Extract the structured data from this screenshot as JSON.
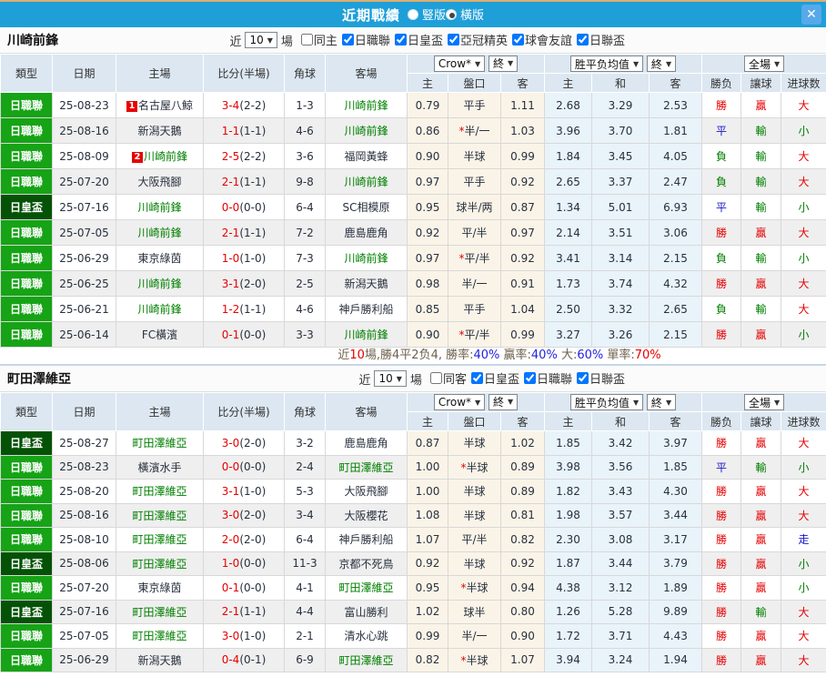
{
  "titlebar": {
    "title": "近期戰績",
    "radio_options": [
      {
        "label": "豎版",
        "selected": false
      },
      {
        "label": "橫版",
        "selected": true
      }
    ],
    "close_glyph": "✕"
  },
  "cup_label": "日皇盃",
  "columns": {
    "type": "類型",
    "date": "日期",
    "home": "主場",
    "score": "比分(半場)",
    "corner": "角球",
    "away": "客場",
    "odds_company": "Crow*",
    "time_final": "終",
    "odds_home": "主",
    "odds_handicap": "盤口",
    "odds_away": "客",
    "avg_label": "胜平负均值",
    "avg_home": "主",
    "avg_draw": "和",
    "avg_away": "客",
    "scope": "全場",
    "result": "勝负",
    "handicap_result": "讓球",
    "goals": "进球数"
  },
  "colors": {
    "topbar_blue": "#1E9FD8",
    "league_badge_green": "#16A316",
    "cup_badge_dark_green": "#045206",
    "win_red": "#E60000",
    "draw_blue": "#1717CC",
    "lose_green": "#008000",
    "team_green": "#008000",
    "odds_bg": "#FAF4E8",
    "avg_bg": "#E9F3FA"
  },
  "sections": [
    {
      "team": "川崎前鋒",
      "filter": {
        "near_label": "近",
        "count": "10",
        "games_label": "場",
        "checkboxes": [
          {
            "label": "同主",
            "checked": false
          },
          {
            "label": "日職聯",
            "checked": true
          },
          {
            "label": "日皇盃",
            "checked": true
          },
          {
            "label": "亞冠精英",
            "checked": true
          },
          {
            "label": "球會友誼",
            "checked": true
          },
          {
            "label": "日聯盃",
            "checked": true
          }
        ]
      },
      "rows": [
        {
          "lg": "日職聯",
          "date": "25-08-23",
          "home": "名古屋八鯨",
          "hb": "1",
          "score": "3-4",
          "half": "(2-2)",
          "corner": "1-3",
          "away": "川崎前鋒",
          "o1": "0.79",
          "hc": "平手",
          "o2": "1.11",
          "a1": "2.68",
          "a2": "3.29",
          "a3": "2.53",
          "res": "勝",
          "hres": "贏",
          "goal": "大"
        },
        {
          "lg": "日職聯",
          "date": "25-08-16",
          "home": "新潟天鵝",
          "score": "1-1",
          "half": "(1-1)",
          "corner": "4-6",
          "away": "川崎前鋒",
          "o1": "0.86",
          "hc": "*半/一",
          "o2": "1.03",
          "a1": "3.96",
          "a2": "3.70",
          "a3": "1.81",
          "res": "平",
          "hres": "輸",
          "goal": "小"
        },
        {
          "lg": "日職聯",
          "date": "25-08-09",
          "home": "川崎前鋒",
          "hb": "2",
          "score": "2-5",
          "half": "(2-2)",
          "corner": "3-6",
          "away": "福岡黃蜂",
          "o1": "0.90",
          "hc": "半球",
          "o2": "0.99",
          "a1": "1.84",
          "a2": "3.45",
          "a3": "4.05",
          "res": "負",
          "hres": "輸",
          "goal": "大"
        },
        {
          "lg": "日職聯",
          "date": "25-07-20",
          "home": "大阪飛腳",
          "score": "2-1",
          "half": "(1-1)",
          "corner": "9-8",
          "away": "川崎前鋒",
          "o1": "0.97",
          "hc": "平手",
          "o2": "0.92",
          "a1": "2.65",
          "a2": "3.37",
          "a3": "2.47",
          "res": "負",
          "hres": "輸",
          "goal": "大"
        },
        {
          "lg": "日皇盃",
          "date": "25-07-16",
          "home": "川崎前鋒",
          "score": "0-0",
          "half": "(0-0)",
          "corner": "6-4",
          "away": "SC相模原",
          "o1": "0.95",
          "hc": "球半/两",
          "o2": "0.87",
          "a1": "1.34",
          "a2": "5.01",
          "a3": "6.93",
          "res": "平",
          "hres": "輸",
          "goal": "小"
        },
        {
          "lg": "日職聯",
          "date": "25-07-05",
          "home": "川崎前鋒",
          "score": "2-1",
          "half": "(1-1)",
          "corner": "7-2",
          "away": "鹿島鹿角",
          "o1": "0.92",
          "hc": "平/半",
          "o2": "0.97",
          "a1": "2.14",
          "a2": "3.51",
          "a3": "3.06",
          "res": "勝",
          "hres": "贏",
          "goal": "大"
        },
        {
          "lg": "日職聯",
          "date": "25-06-29",
          "home": "東京綠茵",
          "score": "1-0",
          "half": "(1-0)",
          "corner": "7-3",
          "away": "川崎前鋒",
          "o1": "0.97",
          "hc": "*平/半",
          "o2": "0.92",
          "a1": "3.41",
          "a2": "3.14",
          "a3": "2.15",
          "res": "負",
          "hres": "輸",
          "goal": "小"
        },
        {
          "lg": "日職聯",
          "date": "25-06-25",
          "home": "川崎前鋒",
          "score": "3-1",
          "half": "(2-0)",
          "corner": "2-5",
          "away": "新潟天鵝",
          "o1": "0.98",
          "hc": "半/一",
          "o2": "0.91",
          "a1": "1.73",
          "a2": "3.74",
          "a3": "4.32",
          "res": "勝",
          "hres": "贏",
          "goal": "大"
        },
        {
          "lg": "日職聯",
          "date": "25-06-21",
          "home": "川崎前鋒",
          "score": "1-2",
          "half": "(1-1)",
          "corner": "4-6",
          "away": "神戶勝利船",
          "o1": "0.85",
          "hc": "平手",
          "o2": "1.04",
          "a1": "2.50",
          "a2": "3.32",
          "a3": "2.65",
          "res": "負",
          "hres": "輸",
          "goal": "大"
        },
        {
          "lg": "日職聯",
          "date": "25-06-14",
          "home": "FC橫濱",
          "score": "0-1",
          "half": "(0-0)",
          "corner": "3-3",
          "away": "川崎前鋒",
          "o1": "0.90",
          "hc": "*平/半",
          "o2": "0.99",
          "a1": "3.27",
          "a2": "3.26",
          "a3": "2.15",
          "res": "勝",
          "hres": "贏",
          "goal": "小"
        }
      ],
      "summary": [
        {
          "t": "近",
          "c": "plain"
        },
        {
          "t": "10",
          "c": "red"
        },
        {
          "t": "場,勝4平2负4, 勝率:",
          "c": "plain"
        },
        {
          "t": "40%",
          "c": "blue"
        },
        {
          "t": " 贏率:",
          "c": "plain"
        },
        {
          "t": "40%",
          "c": "blue"
        },
        {
          "t": " 大:",
          "c": "plain"
        },
        {
          "t": "60%",
          "c": "blue"
        },
        {
          "t": " 單率:",
          "c": "plain"
        },
        {
          "t": "70%",
          "c": "red"
        }
      ]
    },
    {
      "team": "町田澤維亞",
      "filter": {
        "near_label": "近",
        "count": "10",
        "games_label": "場",
        "checkboxes": [
          {
            "label": "同客",
            "checked": false
          },
          {
            "label": "日皇盃",
            "checked": true
          },
          {
            "label": "日職聯",
            "checked": true
          },
          {
            "label": "日聯盃",
            "checked": true
          }
        ]
      },
      "rows": [
        {
          "lg": "日皇盃",
          "date": "25-08-27",
          "home": "町田澤維亞",
          "score": "3-0",
          "half": "(2-0)",
          "corner": "3-2",
          "away": "鹿島鹿角",
          "o1": "0.87",
          "hc": "半球",
          "o2": "1.02",
          "a1": "1.85",
          "a2": "3.42",
          "a3": "3.97",
          "res": "勝",
          "hres": "贏",
          "goal": "大"
        },
        {
          "lg": "日職聯",
          "date": "25-08-23",
          "home": "橫濱水手",
          "score": "0-0",
          "half": "(0-0)",
          "corner": "2-4",
          "away": "町田澤維亞",
          "o1": "1.00",
          "hc": "*半球",
          "o2": "0.89",
          "a1": "3.98",
          "a2": "3.56",
          "a3": "1.85",
          "res": "平",
          "hres": "輸",
          "goal": "小"
        },
        {
          "lg": "日職聯",
          "date": "25-08-20",
          "home": "町田澤維亞",
          "score": "3-1",
          "half": "(1-0)",
          "corner": "5-3",
          "away": "大阪飛腳",
          "o1": "1.00",
          "hc": "半球",
          "o2": "0.89",
          "a1": "1.82",
          "a2": "3.43",
          "a3": "4.30",
          "res": "勝",
          "hres": "贏",
          "goal": "大"
        },
        {
          "lg": "日職聯",
          "date": "25-08-16",
          "home": "町田澤維亞",
          "score": "3-0",
          "half": "(2-0)",
          "corner": "3-4",
          "away": "大阪櫻花",
          "o1": "1.08",
          "hc": "半球",
          "o2": "0.81",
          "a1": "1.98",
          "a2": "3.57",
          "a3": "3.44",
          "res": "勝",
          "hres": "贏",
          "goal": "大"
        },
        {
          "lg": "日職聯",
          "date": "25-08-10",
          "home": "町田澤維亞",
          "score": "2-0",
          "half": "(2-0)",
          "corner": "6-4",
          "away": "神戶勝利船",
          "o1": "1.07",
          "hc": "平/半",
          "o2": "0.82",
          "a1": "2.30",
          "a2": "3.08",
          "a3": "3.17",
          "res": "勝",
          "hres": "贏",
          "goal": "走"
        },
        {
          "lg": "日皇盃",
          "date": "25-08-06",
          "home": "町田澤維亞",
          "score": "1-0",
          "half": "(0-0)",
          "corner": "11-3",
          "away": "京都不死鳥",
          "o1": "0.92",
          "hc": "半球",
          "o2": "0.92",
          "a1": "1.87",
          "a2": "3.44",
          "a3": "3.79",
          "res": "勝",
          "hres": "贏",
          "goal": "小"
        },
        {
          "lg": "日職聯",
          "date": "25-07-20",
          "home": "東京綠茵",
          "score": "0-1",
          "half": "(0-0)",
          "corner": "4-1",
          "away": "町田澤維亞",
          "o1": "0.95",
          "hc": "*半球",
          "o2": "0.94",
          "a1": "4.38",
          "a2": "3.12",
          "a3": "1.89",
          "res": "勝",
          "hres": "贏",
          "goal": "小"
        },
        {
          "lg": "日皇盃",
          "date": "25-07-16",
          "home": "町田澤維亞",
          "score": "2-1",
          "half": "(1-1)",
          "corner": "4-4",
          "away": "富山勝利",
          "o1": "1.02",
          "hc": "球半",
          "o2": "0.80",
          "a1": "1.26",
          "a2": "5.28",
          "a3": "9.89",
          "res": "勝",
          "hres": "輸",
          "goal": "大"
        },
        {
          "lg": "日職聯",
          "date": "25-07-05",
          "home": "町田澤維亞",
          "score": "3-0",
          "half": "(1-0)",
          "corner": "2-1",
          "away": "清水心跳",
          "o1": "0.99",
          "hc": "半/一",
          "o2": "0.90",
          "a1": "1.72",
          "a2": "3.71",
          "a3": "4.43",
          "res": "勝",
          "hres": "贏",
          "goal": "大"
        },
        {
          "lg": "日職聯",
          "date": "25-06-29",
          "home": "新潟天鵝",
          "score": "0-4",
          "half": "(0-1)",
          "corner": "6-9",
          "away": "町田澤維亞",
          "o1": "0.82",
          "hc": "*半球",
          "o2": "1.07",
          "a1": "3.94",
          "a2": "3.24",
          "a3": "1.94",
          "res": "勝",
          "hres": "贏",
          "goal": "大"
        }
      ]
    }
  ]
}
